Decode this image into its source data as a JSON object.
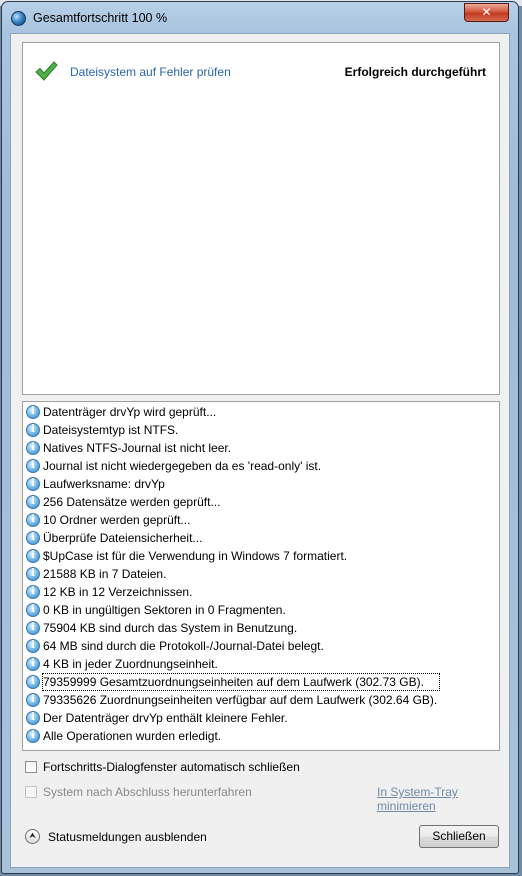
{
  "window": {
    "title": "Gesamtfortschritt 100 %",
    "close_glyph": "✕"
  },
  "task": {
    "label": "Dateisystem auf Fehler prüfen",
    "status": "Erfolgreich durchgeführt",
    "icon": "checkmark-icon",
    "icon_color": "#4fb04a"
  },
  "log": {
    "icon": "info-icon",
    "items": [
      "Datenträger drvYp wird geprüft...",
      "Dateisystemtyp ist NTFS.",
      "Natives NTFS-Journal ist nicht leer.",
      "Journal ist nicht wiedergegeben da es 'read-only' ist.",
      "Laufwerksname: drvYp",
      "256 Datensätze werden geprüft...",
      "10 Ordner werden geprüft...",
      "Überprüfe Dateiensicherheit...",
      "$UpCase ist für die Verwendung in Windows 7 formatiert.",
      "21588 KB in 7 Dateien.",
      "12 KB in 12 Verzeichnissen.",
      "0 KB in ungültigen Sektoren in 0 Fragmenten.",
      "75904 KB sind durch das System in Benutzung.",
      "64 MB sind durch die Protokoll-/Journal-Datei belegt.",
      "4 KB in jeder Zuordnungseinheit.",
      "79359999 Gesamtzuordnungseinheiten auf dem Laufwerk (302.73 GB).",
      "79335626 Zuordnungseinheiten verfügbar auf dem Laufwerk (302.64 GB).",
      "Der Datenträger drvYp enthält kleinere Fehler.",
      "Alle Operationen wurden erledigt."
    ],
    "selected_index": 15
  },
  "options": {
    "auto_close_label": "Fortschritts-Dialogfenster automatisch schließen",
    "auto_close_checked": false,
    "shutdown_label": "System nach Abschluss herunterfahren",
    "shutdown_checked": false,
    "shutdown_enabled": false,
    "tray_link": "In System-Tray minimieren"
  },
  "footer": {
    "toggle_label": "Statusmeldungen ausblenden",
    "toggle_glyph": "⮝",
    "close_button": "Schließen"
  }
}
